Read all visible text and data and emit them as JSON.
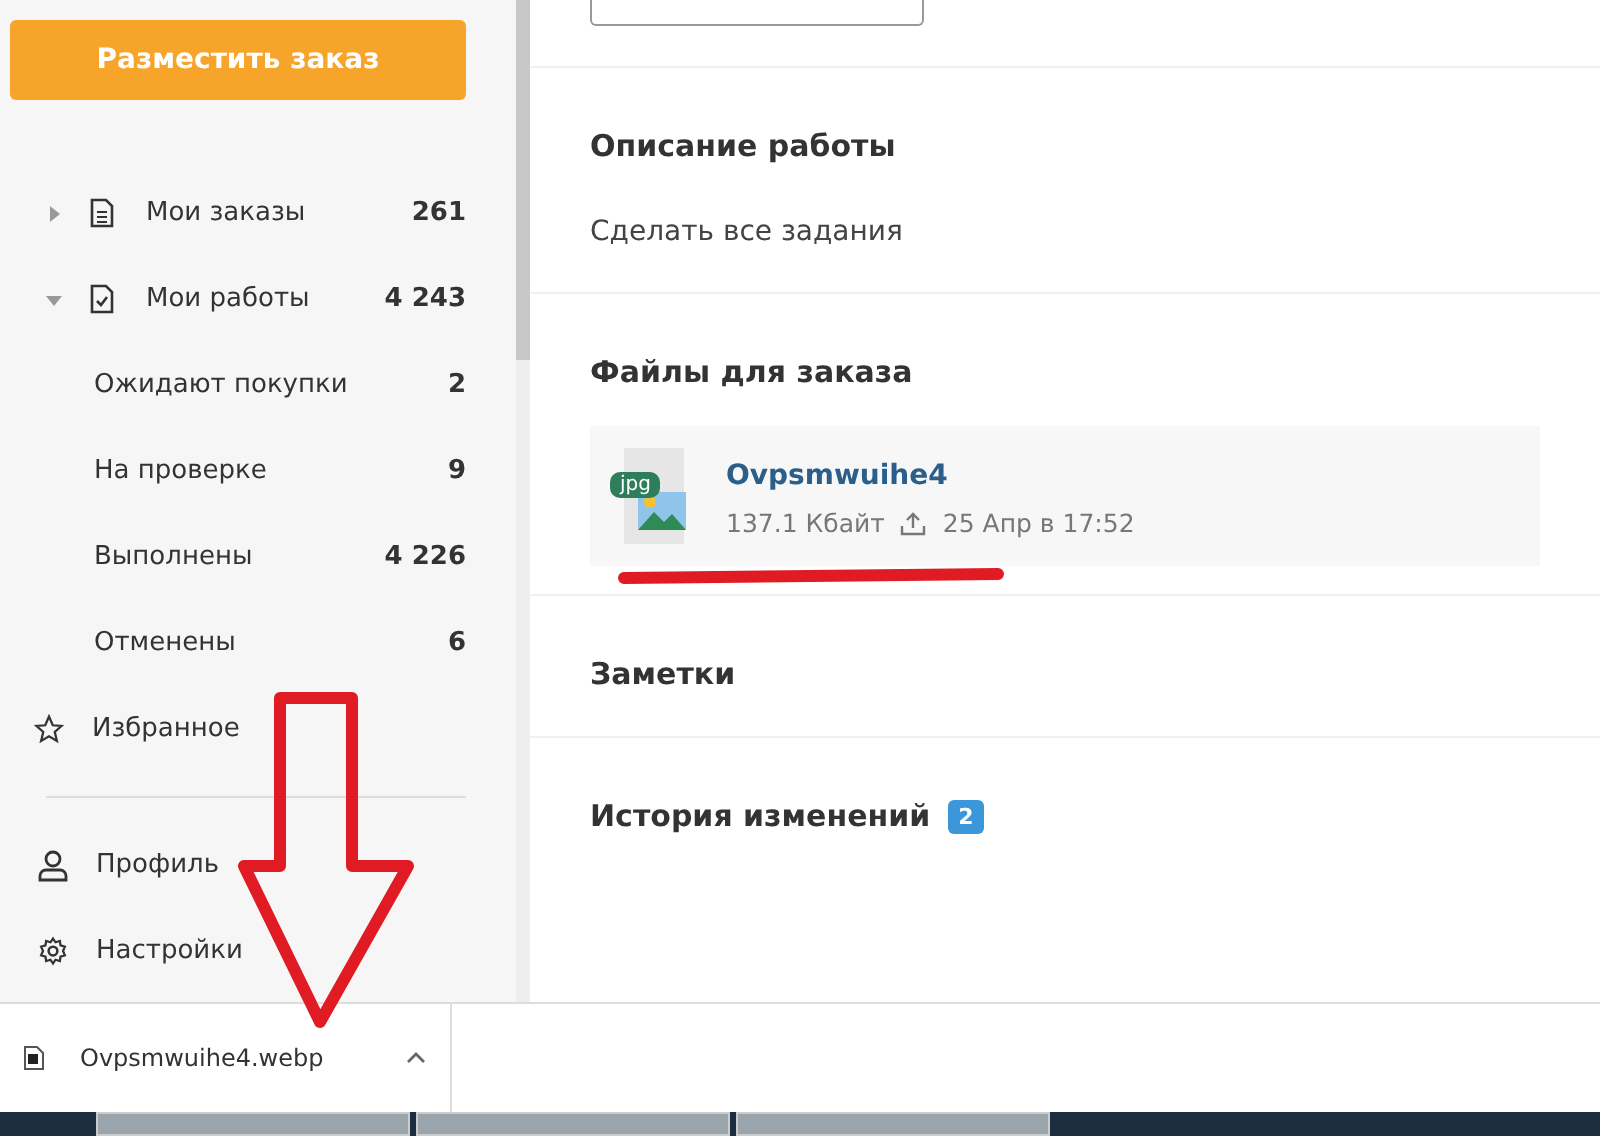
{
  "sidebar": {
    "order_button": "Разместить заказ",
    "items": [
      {
        "kind": "group",
        "label": "Мои заказы",
        "count": "261",
        "expanded": false
      },
      {
        "kind": "group",
        "label": "Мои работы",
        "count": "4 243",
        "expanded": true,
        "children": [
          {
            "label": "Ожидают покупки",
            "count": "2"
          },
          {
            "label": "На проверке",
            "count": "9"
          },
          {
            "label": "Выполнены",
            "count": "4 226"
          },
          {
            "label": "Отменены",
            "count": "6"
          }
        ]
      },
      {
        "kind": "link",
        "label": "Избранное"
      }
    ],
    "bottom_items": [
      {
        "label": "Профиль"
      },
      {
        "label": "Настройки"
      }
    ]
  },
  "main": {
    "sections": [
      {
        "title": "Описание работы",
        "text": "Сделать все задания"
      },
      {
        "title": "Файлы для заказа",
        "files": [
          {
            "ext": "jpg",
            "name": "Ovpsmwuihe4",
            "size": "137.1 Кбайт",
            "date": "25 Апр в 17:52"
          }
        ]
      },
      {
        "title": "Заметки"
      },
      {
        "title": "История изменений",
        "badge": "2"
      }
    ]
  },
  "download_bar": {
    "items": [
      {
        "name": "Ovpsmwuihe4.webp"
      }
    ]
  }
}
